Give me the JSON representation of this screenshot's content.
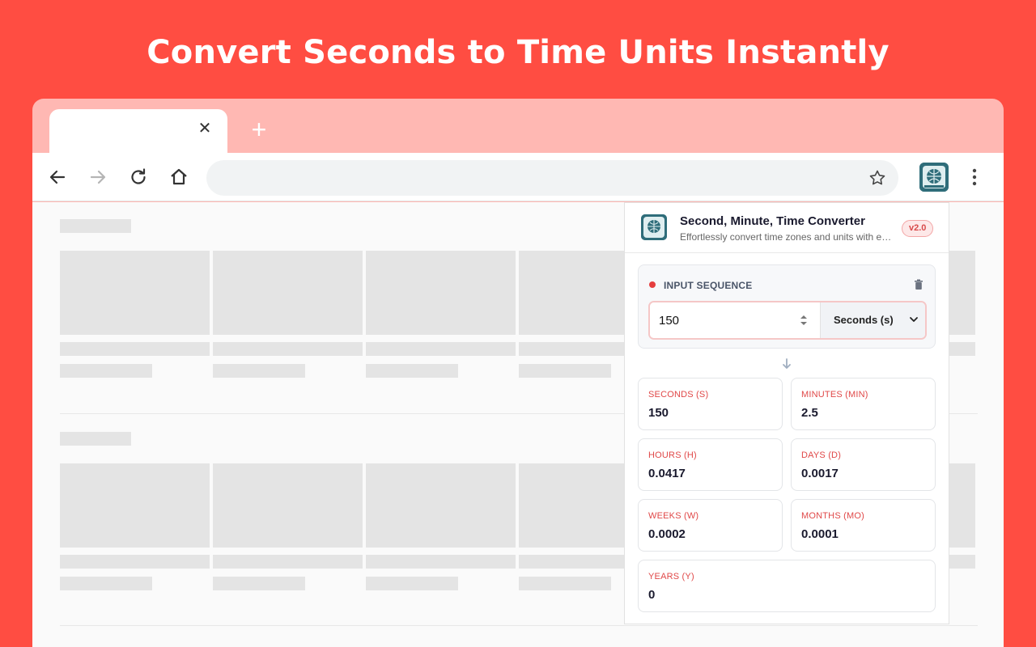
{
  "headline": "Convert Seconds to Time Units Instantly",
  "browser": {
    "tab_close": "✕",
    "new_tab": "+"
  },
  "extension": {
    "title": "Second, Minute, Time Converter",
    "subtitle": "Effortlessly convert time zones and units with ease",
    "version": "v2.0",
    "input_label": "INPUT SEQUENCE",
    "input_value": "150",
    "unit_selected": "Seconds (s)",
    "results": [
      {
        "label": "SECONDS (S)",
        "value": "150"
      },
      {
        "label": "MINUTES (MIN)",
        "value": "2.5"
      },
      {
        "label": "HOURS (H)",
        "value": "0.0417"
      },
      {
        "label": "DAYS (D)",
        "value": "0.0017"
      },
      {
        "label": "WEEKS (W)",
        "value": "0.0002"
      },
      {
        "label": "MONTHS (MO)",
        "value": "0.0001"
      },
      {
        "label": "YEARS (Y)",
        "value": "0"
      }
    ]
  },
  "colors": {
    "background": "#FF4D42",
    "accent": "#E53E3E",
    "tabstrip": "#FFB8B3"
  }
}
